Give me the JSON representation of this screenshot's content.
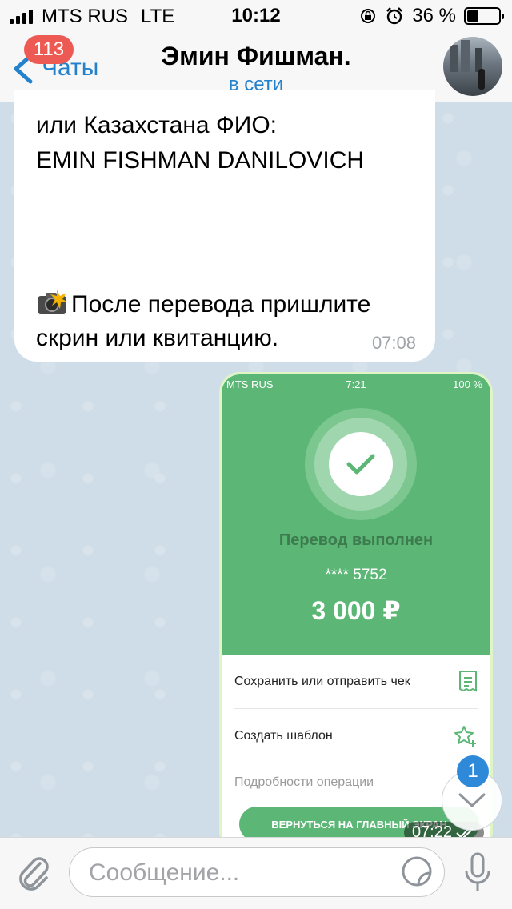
{
  "status_bar": {
    "carrier": "MTS RUS",
    "network": "LTE",
    "time": "10:12",
    "battery": "36 %",
    "battery_level": 0.36
  },
  "nav": {
    "back_label": "Чаты",
    "unread_count": "113",
    "title": "Эмин Фишман.",
    "status": "в сети"
  },
  "incoming_message": {
    "lines": [
      "или Казахстана ФИО:",
      "EMIN FISHMAN DANILOVICH",
      "После перевода пришлите",
      "скрин или квитанцию."
    ],
    "time": "07:08"
  },
  "photo_message": {
    "inner_status": {
      "carrier": "MTS RUS",
      "time": "7:21",
      "battery": "100 %"
    },
    "transfer_status": "Перевод выполнен",
    "card_mask": "**** 5752",
    "amount": "3 000 ₽",
    "actions": [
      "Сохранить или отправить чек",
      "Создать шаблон",
      "Подробности операции"
    ],
    "return_button": "ВЕРНУТЬСЯ НА ГЛАВНЫЙ ЭКРАН",
    "time": "07:22"
  },
  "scroll_down": {
    "badge": "1"
  },
  "input_bar": {
    "placeholder": "Сообщение..."
  },
  "colors": {
    "accent": "#2481cc",
    "badge_red": "#ed5a53",
    "sber_green": "#5cb776",
    "outgoing_border": "#dff5c6"
  },
  "icons": [
    "back-chevron-icon",
    "paperclip-icon",
    "sticker-icon",
    "microphone-icon",
    "camera-flash-icon",
    "checkmark-icon",
    "receipt-icon",
    "star-plus-icon",
    "chevron-down-icon",
    "double-check-icon"
  ]
}
